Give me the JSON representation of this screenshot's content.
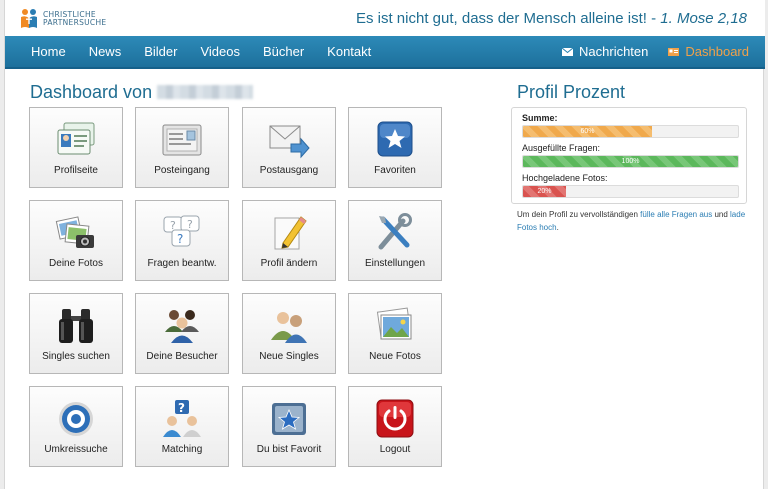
{
  "header": {
    "logo_line1": "CHRISTLICHE",
    "logo_line2": "PARTNERSUCHE",
    "motto": "Es ist nicht gut, dass der Mensch alleine ist! - ",
    "motto_ref": "1. Mose 2,18"
  },
  "nav": {
    "left": [
      "Home",
      "News",
      "Bilder",
      "Videos",
      "Bücher",
      "Kontakt"
    ],
    "messages": "Nachrichten",
    "dashboard": "Dashboard"
  },
  "dashboard": {
    "title": "Dashboard von",
    "tiles": [
      {
        "label": "Profilseite",
        "icon": "profile-card-icon"
      },
      {
        "label": "Posteingang",
        "icon": "inbox-envelope-icon"
      },
      {
        "label": "Postausgang",
        "icon": "outbox-envelope-icon"
      },
      {
        "label": "Favoriten",
        "icon": "star-icon"
      },
      {
        "label": "Deine Fotos",
        "icon": "camera-photos-icon"
      },
      {
        "label": "Fragen beantw.",
        "icon": "question-bubbles-icon"
      },
      {
        "label": "Profil ändern",
        "icon": "pencil-paper-icon"
      },
      {
        "label": "Einstellungen",
        "icon": "tools-icon"
      },
      {
        "label": "Singles suchen",
        "icon": "binoculars-icon"
      },
      {
        "label": "Deine Besucher",
        "icon": "visitors-group-icon"
      },
      {
        "label": "Neue Singles",
        "icon": "two-users-icon"
      },
      {
        "label": "Neue Fotos",
        "icon": "photo-stack-icon"
      },
      {
        "label": "Umkreissuche",
        "icon": "target-icon"
      },
      {
        "label": "Matching",
        "icon": "matching-users-icon"
      },
      {
        "label": "Du bist Favorit",
        "icon": "favorite-folder-icon"
      },
      {
        "label": "Logout",
        "icon": "power-icon"
      }
    ]
  },
  "profile": {
    "title": "Profil Prozent",
    "sum_label": "Summe:",
    "sum_pct": 60,
    "sum_text": "60%",
    "questions_label": "Ausgefüllte Fragen:",
    "questions_pct": 100,
    "questions_text": "100%",
    "photos_label": "Hochgeladene Fotos:",
    "photos_pct": 20,
    "photos_text": "20%",
    "note_1": "Um dein Profil zu vervollständigen ",
    "link_1": "fülle alle Fragen aus",
    "note_2": " und ",
    "link_2": "lade Fotos hoch",
    "note_3": "."
  },
  "colors": {
    "brand": "#1f6d91",
    "nav": "#2581b0",
    "active": "#f0a14a"
  }
}
